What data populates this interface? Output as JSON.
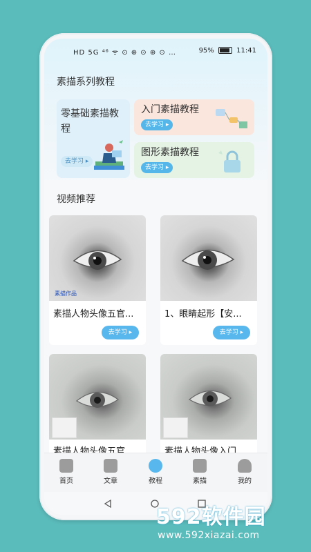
{
  "status": {
    "left": "HD 5G ⁴⁶ ᯤ ⊙ ⊕ ⊙ ⊕ ⊙ …",
    "battery": "95%",
    "time": "11:41"
  },
  "sections": {
    "series_title": "素描系列教程",
    "video_title": "视频推荐"
  },
  "series_cards": [
    {
      "title": "零基础素描教程",
      "button": "去学习 ▸"
    },
    {
      "title": "入门素描教程",
      "button": "去学习 ▸"
    },
    {
      "title": "图形素描教程",
      "button": "去学习 ▸"
    }
  ],
  "videos": [
    {
      "title": "素描人物头像五官...",
      "button": "去学习 ▸",
      "signature": "素描作品"
    },
    {
      "title": "1、眼睛起形【安...",
      "button": "去学习 ▸"
    },
    {
      "title": "素描人物头像五官",
      "button": ""
    },
    {
      "title": "素描人物头像入门",
      "button": ""
    }
  ],
  "nav": [
    {
      "label": "首页",
      "icon": "home-icon"
    },
    {
      "label": "文章",
      "icon": "article-icon"
    },
    {
      "label": "教程",
      "icon": "play-icon"
    },
    {
      "label": "素描",
      "icon": "pencil-icon"
    },
    {
      "label": "我的",
      "icon": "profile-icon"
    }
  ],
  "watermark": {
    "brand": "592软件园",
    "url": "www.592xiazai.com"
  },
  "colors": {
    "background": "#5bbcbc",
    "accent": "#58b7ec",
    "card_blue": "#dff0fa",
    "card_orange": "#fbe6dd",
    "card_green": "#e5f3e4"
  }
}
